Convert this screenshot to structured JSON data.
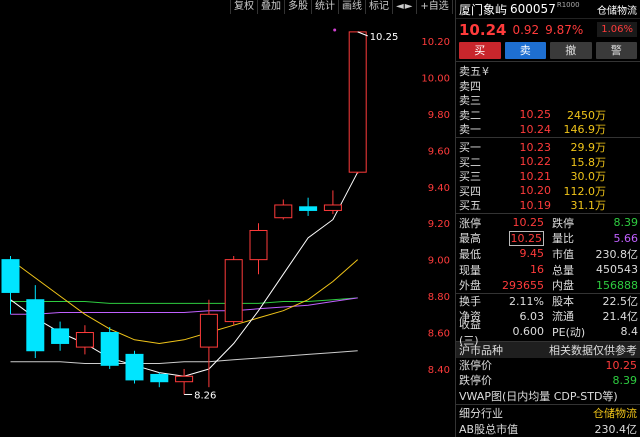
{
  "toolbar": {
    "items": [
      "复权",
      "叠加",
      "多股",
      "统计",
      "画线",
      "标记",
      "◄►",
      "+自选",
      "返回"
    ]
  },
  "chart": {
    "price_labels": [
      "10.20",
      "10.00",
      "9.80",
      "9.60",
      "9.40",
      "9.20",
      "9.00",
      "8.80",
      "8.60",
      "8.40"
    ],
    "price_levels": [
      10.2,
      10.0,
      9.8,
      9.6,
      9.4,
      9.2,
      9.0,
      8.8,
      8.6,
      8.4
    ],
    "high_annotation": "10.25",
    "low_annotation": "8.26",
    "colors": {
      "up": "#ff3b3b",
      "down": "#00e5ff",
      "ma5": "#ffffff",
      "ma10": "#f0c419",
      "ma20": "#c060ff",
      "ma60": "#2ecc40",
      "axis_text": "#ff3b3b"
    }
  },
  "chart_data": {
    "type": "candlestick",
    "ylim": [
      8.26,
      10.27
    ],
    "candles": [
      {
        "open": 9.0,
        "close": 8.82,
        "high": 9.02,
        "low": 8.7,
        "dir": "down"
      },
      {
        "open": 8.78,
        "close": 8.5,
        "high": 8.86,
        "low": 8.46,
        "dir": "down"
      },
      {
        "open": 8.62,
        "close": 8.54,
        "high": 8.66,
        "low": 8.5,
        "dir": "down"
      },
      {
        "open": 8.52,
        "close": 8.6,
        "high": 8.64,
        "low": 8.48,
        "dir": "up"
      },
      {
        "open": 8.6,
        "close": 8.42,
        "high": 8.63,
        "low": 8.4,
        "dir": "down"
      },
      {
        "open": 8.48,
        "close": 8.34,
        "high": 8.5,
        "low": 8.32,
        "dir": "down"
      },
      {
        "open": 8.37,
        "close": 8.33,
        "high": 8.38,
        "low": 8.3,
        "dir": "down"
      },
      {
        "open": 8.33,
        "close": 8.36,
        "high": 8.4,
        "low": 8.26,
        "dir": "up"
      },
      {
        "open": 8.52,
        "close": 8.7,
        "high": 8.78,
        "low": 8.3,
        "dir": "up"
      },
      {
        "open": 8.66,
        "close": 9.0,
        "high": 9.02,
        "low": 8.64,
        "dir": "up"
      },
      {
        "open": 9.0,
        "close": 9.16,
        "high": 9.2,
        "low": 8.92,
        "dir": "up"
      },
      {
        "open": 9.23,
        "close": 9.3,
        "high": 9.33,
        "low": 9.22,
        "dir": "up"
      },
      {
        "open": 9.29,
        "close": 9.27,
        "high": 9.34,
        "low": 9.24,
        "dir": "down"
      },
      {
        "open": 9.27,
        "close": 9.3,
        "high": 9.38,
        "low": 9.25,
        "dir": "up"
      },
      {
        "open": 9.48,
        "close": 10.25,
        "high": 10.25,
        "low": 9.47,
        "dir": "up"
      }
    ],
    "ma5": [
      8.78,
      8.68,
      8.6,
      8.54,
      8.46,
      8.42,
      8.38,
      8.36,
      8.4,
      8.54,
      8.72,
      8.92,
      9.12,
      9.22,
      9.48
    ],
    "ma10": [
      9.0,
      8.9,
      8.8,
      8.7,
      8.62,
      8.56,
      8.54,
      8.56,
      8.6,
      8.64,
      8.68,
      8.72,
      8.78,
      8.88,
      9.0
    ],
    "ma20": [
      8.7,
      8.7,
      8.71,
      8.71,
      8.71,
      8.71,
      8.71,
      8.71,
      8.72,
      8.72,
      8.73,
      8.74,
      8.75,
      8.77,
      8.79
    ],
    "ma60": [
      8.77,
      8.77,
      8.77,
      8.77,
      8.76,
      8.76,
      8.76,
      8.76,
      8.76,
      8.76,
      8.76,
      8.77,
      8.77,
      8.78,
      8.79
    ],
    "ma_base": [
      8.44,
      8.44,
      8.44,
      8.43,
      8.43,
      8.43,
      8.43,
      8.44,
      8.44,
      8.45,
      8.46,
      8.47,
      8.48,
      8.49,
      8.5
    ]
  },
  "header": {
    "name": "厦门象屿",
    "code": "600057",
    "tag": "R",
    "tag2": "1000",
    "industry": "仓储物流"
  },
  "quote": {
    "price": "10.24",
    "change": "0.92",
    "pct": "9.87%",
    "rate": "1.06%"
  },
  "actions": {
    "buy": "买",
    "sell": "卖",
    "cancel": "撤",
    "alert": "警"
  },
  "sells": [
    {
      "label": "卖五",
      "price": "",
      "vol": "",
      "sym": "¥"
    },
    {
      "label": "卖四",
      "price": "",
      "vol": "",
      "sym": ""
    },
    {
      "label": "卖三",
      "price": "",
      "vol": "",
      "sym": ""
    },
    {
      "label": "卖二",
      "price": "10.25",
      "vol": "2450万",
      "sym": ""
    },
    {
      "label": "卖一",
      "price": "10.24",
      "vol": "146.9万",
      "sym": ""
    }
  ],
  "buys": [
    {
      "label": "买一",
      "price": "10.23",
      "vol": "29.9万"
    },
    {
      "label": "买二",
      "price": "10.22",
      "vol": "15.8万"
    },
    {
      "label": "买三",
      "price": "10.21",
      "vol": "30.0万"
    },
    {
      "label": "买四",
      "price": "10.20",
      "vol": "112.0万"
    },
    {
      "label": "买五",
      "price": "10.19",
      "vol": "31.1万"
    }
  ],
  "stats": [
    {
      "l1": "涨停",
      "v1": "10.25",
      "c1": "red",
      "l2": "跌停",
      "v2": "8.39",
      "c2": "grn"
    },
    {
      "l1": "最高",
      "v1": "10.25",
      "c1": "red",
      "l2": "量比",
      "v2": "5.66",
      "c2": "pur",
      "boxed": true
    },
    {
      "l1": "最低",
      "v1": "9.45",
      "c1": "red",
      "l2": "市值",
      "v2": "230.8亿",
      "c2": "wht"
    },
    {
      "l1": "现量",
      "v1": "16",
      "c1": "red",
      "l2": "总量",
      "v2": "450543",
      "c2": "wht"
    },
    {
      "l1": "外盘",
      "v1": "293655",
      "c1": "red",
      "l2": "内盘",
      "v2": "156888",
      "c2": "grn"
    },
    {
      "l1": "换手",
      "v1": "2.11%",
      "c1": "wht",
      "l2": "股本",
      "v2": "22.5亿",
      "c2": "wht",
      "sep": true
    },
    {
      "l1": "净资",
      "v1": "6.03",
      "c1": "wht",
      "l2": "流通",
      "v2": "21.4亿",
      "c2": "wht"
    },
    {
      "l1": "收益(三)",
      "v1": "0.600",
      "c1": "wht",
      "l2": "PE(动)",
      "v2": "8.4",
      "c2": "wht"
    }
  ],
  "section": {
    "left": "沪市品种",
    "right": "相关数据仅供参考",
    "limit_up_label": "涨停价",
    "limit_up": "10.25",
    "limit_down_label": "跌停价",
    "limit_down": "8.39",
    "vwap": "VWAP图(日内均量 CDP-STD等)",
    "industry_label": "细分行业",
    "industry": "仓储物流",
    "ab_label": "AB股总市值",
    "ab_value": "230.4亿"
  }
}
